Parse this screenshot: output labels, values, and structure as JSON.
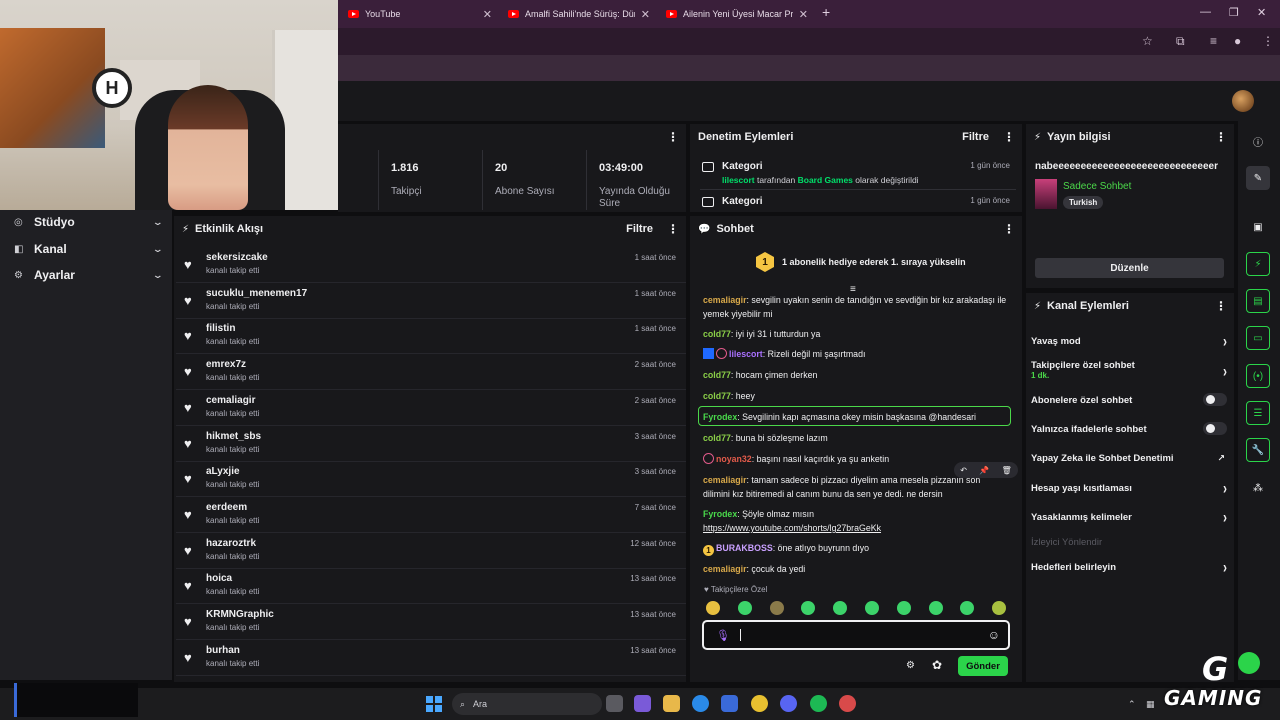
{
  "browser": {
    "tabs": [
      {
        "title": "YouTube"
      },
      {
        "title": "Amalfi Sahili'nde Sürüş: Dünyan"
      },
      {
        "title": "Ailenin Yeni Üyesi Macar Prens"
      }
    ]
  },
  "webcam": {
    "logo_text": "H"
  },
  "sidebar": {
    "items": [
      {
        "label": "Stüdyo"
      },
      {
        "label": "Kanal"
      },
      {
        "label": "Ayarlar"
      }
    ]
  },
  "stats": [
    {
      "value": "1.816",
      "label": "Takipçi"
    },
    {
      "value": "20",
      "label": "Abone Sayısı"
    },
    {
      "value": "03:49:00",
      "label": "Yayında Olduğu Süre"
    }
  ],
  "activity": {
    "title": "Etkinlik Akışı",
    "filter": "Filtre",
    "items": [
      {
        "name": "sekersizcake",
        "action": "kanalı takip etti",
        "time": "1 saat önce"
      },
      {
        "name": "sucuklu_menemen17",
        "action": "kanalı takip etti",
        "time": "1 saat önce"
      },
      {
        "name": "filistin",
        "action": "kanalı takip etti",
        "time": "1 saat önce"
      },
      {
        "name": "emrex7z",
        "action": "kanalı takip etti",
        "time": "2 saat önce"
      },
      {
        "name": "cemaliagir",
        "action": "kanalı takip etti",
        "time": "2 saat önce"
      },
      {
        "name": "hikmet_sbs",
        "action": "kanalı takip etti",
        "time": "3 saat önce"
      },
      {
        "name": "aLyxjie",
        "action": "kanalı takip etti",
        "time": "3 saat önce"
      },
      {
        "name": "eerdeem",
        "action": "kanalı takip etti",
        "time": "7 saat önce"
      },
      {
        "name": "hazaroztrk",
        "action": "kanalı takip etti",
        "time": "12 saat önce"
      },
      {
        "name": "hoica",
        "action": "kanalı takip etti",
        "time": "13 saat önce"
      },
      {
        "name": "KRMNGraphic",
        "action": "kanalı takip etti",
        "time": "13 saat önce"
      },
      {
        "name": "burhan",
        "action": "kanalı takip etti",
        "time": "13 saat önce"
      }
    ]
  },
  "moderation": {
    "title": "Denetim Eylemleri",
    "filter": "Filtre",
    "items": [
      {
        "title": "Kategori",
        "time": "1 gün önce",
        "user": "lilescort",
        "text1": " tarafından ",
        "category": "Board Games",
        "text2": " olarak değiştirildi"
      },
      {
        "title": "Kategori",
        "time": "1 gün önce"
      }
    ]
  },
  "chat": {
    "title": "Sohbet",
    "goal": "1 abonelik hediye ederek 1. sıraya yükselin",
    "goal_rank": "1",
    "messages": [
      {
        "user": "cemaliagir",
        "text": ": sevgilin uyakın senin de tanıdığın ve sevdiğin bir kız arakadaşı ile yemek yiyebilir mi"
      },
      {
        "user": "cold77",
        "text": ": iyi iyi 31 i tutturdun ya"
      },
      {
        "user": "lilescort",
        "text": ": Rizeli değil mi şaşırtmadı"
      },
      {
        "user": "cold77",
        "text": ": hocam çimen derken"
      },
      {
        "user": "cold77",
        "text": ": heey"
      },
      {
        "user": "Fyrodex",
        "text": ": Sevgilinin kapı açmasına okey misin başkasına @handesari"
      },
      {
        "user": "cold77",
        "text": ": buna bi sözleşme lazım"
      },
      {
        "user": "noyan32",
        "text": ": başını nasıl kaçırdık ya şu anketin"
      },
      {
        "user": "cemaliagir",
        "text": ": tamam sadece bi pizzacı diyelim ama mesela pizzanın son dilimini kız bitiremedi al canım bunu da sen ye dedi. ne dersin"
      },
      {
        "user": "Fyrodex",
        "text": ": Şöyle olmaz mısın",
        "link": "https://www.youtube.com/shorts/lg27braGeKk"
      },
      {
        "user": "BURAKBOSS",
        "text": ": öne atlıyo buyrunn dıyo",
        "badge": "1"
      },
      {
        "user": "cemaliagir",
        "text": ": çocuk da yedi"
      }
    ],
    "follower_only": "Takipçilere Özel",
    "send_label": "Gönder",
    "input_value": ""
  },
  "stream_info": {
    "title": "Yayın bilgisi",
    "stream_title": "nabeeeeeeeeeeeeeeeeeeeeeeeeeeeeer",
    "category": "Sadece Sohbet",
    "tag": "Turkish",
    "edit_label": "Düzenle"
  },
  "channel_actions": {
    "title": "Kanal Eylemleri",
    "items": [
      {
        "label": "Yavaş mod"
      },
      {
        "label": "Takipçilere özel sohbet",
        "sub": "1 dk."
      },
      {
        "label": "Abonelere özel sohbet"
      },
      {
        "label": "Yalnızca ifadelerle sohbet"
      },
      {
        "label": "Yapay Zeka ile Sohbet Denetimi"
      },
      {
        "label": "Hesap yaşı kısıtlaması"
      },
      {
        "label": "Yasaklanmış kelimeler"
      },
      {
        "label": "İzleyici Yönlendir"
      },
      {
        "label": "Hedefleri belirleyin"
      }
    ]
  },
  "taskbar": {
    "search_label": "Ara"
  },
  "overlay": {
    "g_letter": "G",
    "word": "GAMING"
  },
  "colors": {
    "accent": "#2bd44a",
    "background": "#0e0e10",
    "panel": "#18181b",
    "browser_tabbar": "#3a1f3a"
  }
}
